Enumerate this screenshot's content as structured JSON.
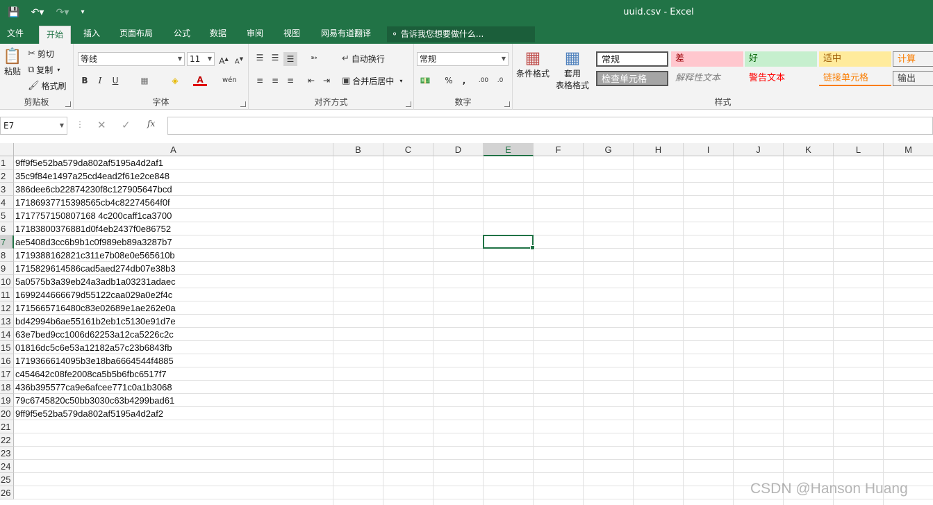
{
  "window": {
    "title": "uuid.csv - Excel"
  },
  "quick_access": {
    "save_icon": "save-icon",
    "undo_icon": "undo-icon",
    "redo_icon": "redo-icon",
    "customize_icon": "customize-qat-icon"
  },
  "menu": {
    "tabs": [
      "文件",
      "开始",
      "插入",
      "页面布局",
      "公式",
      "数据",
      "审阅",
      "视图",
      "网易有道翻译"
    ],
    "active_index": 1,
    "tell_me": "告诉我您想要做什么..."
  },
  "ribbon": {
    "clipboard": {
      "label": "剪贴板",
      "paste": "粘贴",
      "cut": "剪切",
      "copy": "复制",
      "format_painter": "格式刷"
    },
    "font": {
      "label": "字体",
      "font_name": "等线",
      "font_size": "11"
    },
    "alignment": {
      "label": "对齐方式",
      "wrap_text": "自动换行",
      "merge_center": "合并后居中"
    },
    "number": {
      "label": "数字",
      "format": "常规"
    },
    "styles": {
      "label": "样式",
      "conditional_format": "条件格式",
      "table_format_line1": "套用",
      "table_format_line2": "表格格式",
      "cells": [
        {
          "text": "常规",
          "bg": "#ffffff",
          "fg": "#222222"
        },
        {
          "text": "差",
          "bg": "#ffc7ce",
          "fg": "#9c0006"
        },
        {
          "text": "好",
          "bg": "#c6efce",
          "fg": "#006100"
        },
        {
          "text": "适中",
          "bg": "#ffeb9c",
          "fg": "#9c5700"
        },
        {
          "text": "计算",
          "bg": "#f2f2f2",
          "fg": "#fa7d00"
        },
        {
          "text": "检查单元格",
          "bg": "#a5a5a5",
          "fg": "#ffffff"
        },
        {
          "text": "解释性文本",
          "bg": "#f3f3f3",
          "fg": "#7f7f7f"
        },
        {
          "text": "警告文本",
          "bg": "#f3f3f3",
          "fg": "#ff0000"
        },
        {
          "text": "链接单元格",
          "bg": "#f3f3f3",
          "fg": "#fa7d00"
        },
        {
          "text": "输出",
          "bg": "#f2f2f2",
          "fg": "#3f3f3f"
        }
      ]
    }
  },
  "formula_bar": {
    "name_box": "E7",
    "formula": ""
  },
  "sheet": {
    "columns": [
      "A",
      "B",
      "C",
      "D",
      "E",
      "F",
      "G",
      "H",
      "I",
      "J",
      "K",
      "L",
      "M"
    ],
    "rows": [
      "1",
      "2",
      "3",
      "4",
      "5",
      "6",
      "7",
      "8",
      "9",
      "10",
      "11",
      "12",
      "13",
      "14",
      "15",
      "16",
      "17",
      "18",
      "19",
      "20",
      "21",
      "22",
      "23",
      "24",
      "25",
      "26"
    ],
    "selected_cell": "E7",
    "col_a_values": [
      "9ff9f5e52ba579da802af5195a4d2af1",
      "35c9f84e1497a25cd4ead2f61e2ce848",
      "386dee6cb22874230f8c127905647bcd",
      "17186937715398565cb4c82274564f0f",
      "1717757150807168 4c200caff1ca3700",
      "17183800376881d0f4eb2437f0e86752",
      "ae5408d3cc6b9b1c0f989eb89a3287b7",
      "1719388162821c311e7b08e0e565610b",
      "1715829614586cad5aed274db07e38b3",
      "5a0575b3a39eb24a3adb1a03231adaec",
      "1699244666679d55122caa029a0e2f4c",
      "1715665716480c83e02689e1ae262e0a",
      "bd42994b6ae55161b2eb1c5130e91d7e",
      "63e7bed9cc1006d62253a12ca5226c2c",
      "01816dc5c6e53a12182a57c23b6843fb",
      "1719366614095b3e18ba6664544f4885",
      "c454642c08fe2008ca5b5b6fbc6517f7",
      "436b395577ca9e6afcee771c0a1b3068",
      "79c6745820c50bb3030c63b4299bad61",
      "9ff9f5e52ba579da802af5195a4d2af2"
    ]
  },
  "watermark": "CSDN @Hanson Huang",
  "colors": {
    "excel_green": "#217346"
  }
}
